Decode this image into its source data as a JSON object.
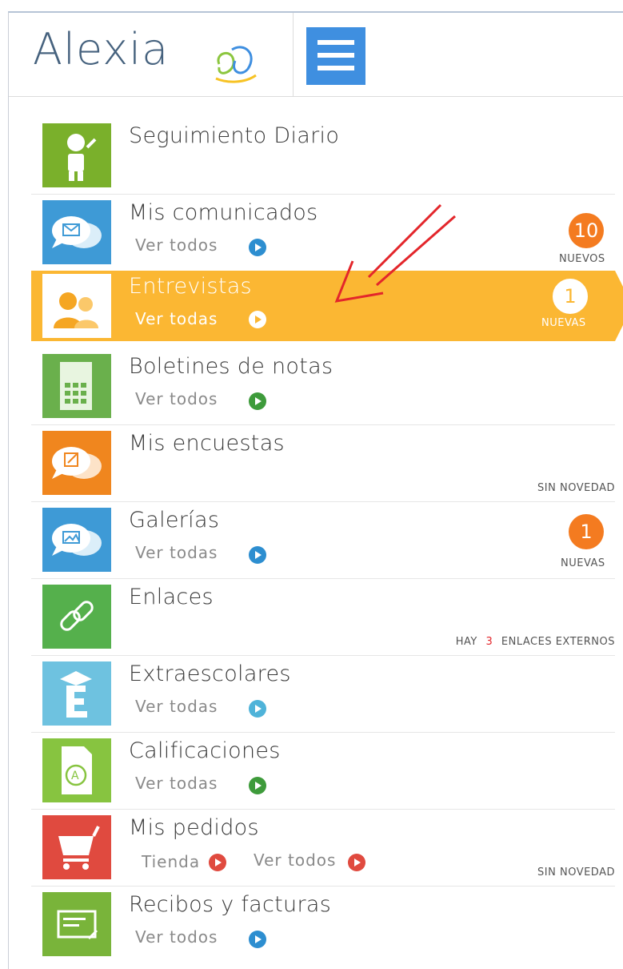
{
  "header": {
    "logo_text": "Alexia",
    "menu_icon": "hamburger-icon",
    "brand_color": "#3f8fe0"
  },
  "items": [
    {
      "title": "Seguimiento Diario",
      "icon": "child-figure-icon",
      "icon_color": "#7ab02b"
    },
    {
      "title": "Mis comunicados",
      "link": "Ver todos",
      "icon": "message-bubbles-icon",
      "icon_color": "#3e9ad6",
      "badge": "10",
      "badge_label": "NUEVOS"
    },
    {
      "title": "Entrevistas",
      "link": "Ver todas",
      "icon": "people-icon",
      "icon_color": "#fbb733",
      "badge": "1",
      "badge_label": "NUEVAS",
      "active": true
    },
    {
      "title": "Boletines de notas",
      "link": "Ver todos",
      "icon": "document-grid-icon",
      "icon_color": "#6ab04c"
    },
    {
      "title": "Mis encuestas",
      "icon": "survey-bubbles-icon",
      "icon_color": "#f0861e",
      "status": "SIN NOVEDAD"
    },
    {
      "title": "Galerías",
      "link": "Ver todas",
      "icon": "gallery-bubbles-icon",
      "icon_color": "#3e9ad6",
      "badge": "1",
      "badge_label": "NUEVAS"
    },
    {
      "title": "Enlaces",
      "icon": "link-icon",
      "icon_color": "#55b04c",
      "status_prefix": "HAY",
      "status_count": "3",
      "status_suffix": "ENLACES EXTERNOS"
    },
    {
      "title": "Extraescolares",
      "link": "Ver todas",
      "icon": "graduation-e-icon",
      "icon_color": "#6ec2e0"
    },
    {
      "title": "Calificaciones",
      "link": "Ver todas",
      "icon": "grade-document-icon",
      "icon_color": "#87c440"
    },
    {
      "title": "Mis pedidos",
      "link": "Ver todos",
      "shop": "Tienda",
      "icon": "shopping-cart-icon",
      "icon_color": "#e04a3f",
      "status": "SIN NOVEDAD"
    },
    {
      "title": "Recibos y facturas",
      "link": "Ver todos",
      "icon": "receipt-icon",
      "icon_color": "#79b43a"
    }
  ]
}
